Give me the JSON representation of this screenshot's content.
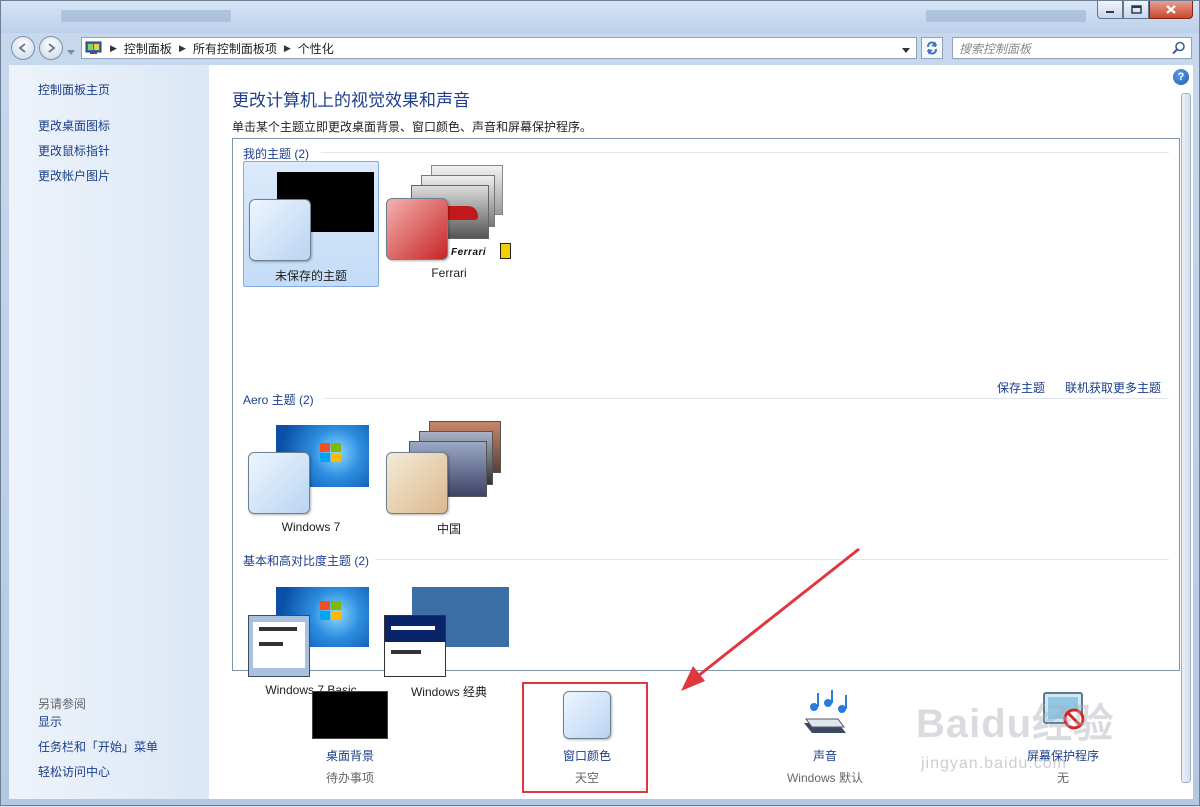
{
  "window": {
    "breadcrumb": [
      "控制面板",
      "所有控制面板项",
      "个性化"
    ],
    "search_placeholder": "搜索控制面板"
  },
  "sidebar": {
    "home": "控制面板主页",
    "links": [
      "更改桌面图标",
      "更改鼠标指针",
      "更改帐户图片"
    ],
    "see_also_title": "另请参阅",
    "see_also": [
      "显示",
      "任务栏和「开始」菜单",
      "轻松访问中心"
    ]
  },
  "main": {
    "title": "更改计算机上的视觉效果和声音",
    "subtitle": "单击某个主题立即更改桌面背景、窗口颜色、声音和屏幕保护程序。",
    "groups": [
      {
        "header": "我的主题 (2)",
        "themes": [
          "未保存的主题",
          "Ferrari"
        ]
      },
      {
        "header": "Aero 主题 (2)",
        "themes": [
          "Windows 7",
          "中国"
        ]
      },
      {
        "header": "基本和高对比度主题 (2)",
        "themes": [
          "Windows 7 Basic",
          "Windows 经典"
        ]
      }
    ],
    "save_theme": "保存主题",
    "get_more_themes": "联机获取更多主题",
    "ferrari_logo": "Ferrari"
  },
  "bottom": [
    {
      "name": "桌面背景",
      "value": "待办事项"
    },
    {
      "name": "窗口颜色",
      "value": "天空"
    },
    {
      "name": "声音",
      "value": "Windows 默认"
    },
    {
      "name": "屏幕保护程序",
      "value": "无"
    }
  ],
  "watermark": {
    "line1": "Baidu经验",
    "line2": "jingyan.baidu.com"
  },
  "colors": {
    "link": "#1b3e8a",
    "title": "#1e3f8f",
    "highlight_box": "#e0363d",
    "annotation_arrow": "#e0363d"
  }
}
